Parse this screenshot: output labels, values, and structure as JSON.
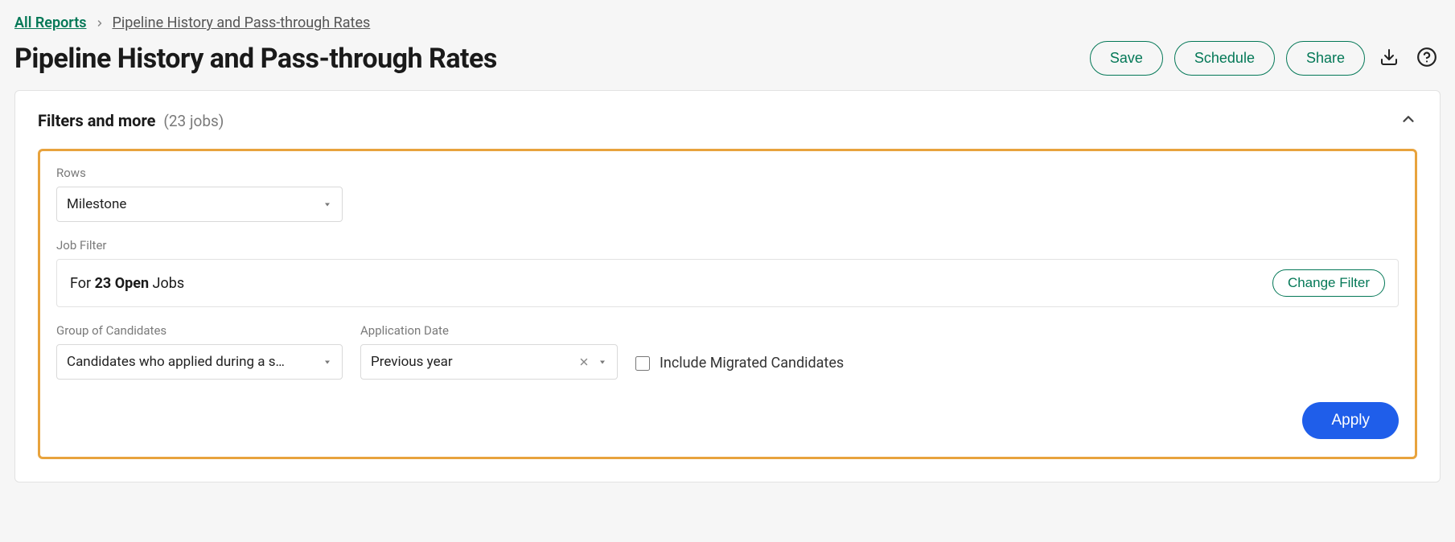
{
  "breadcrumb": {
    "root": "All Reports",
    "current": "Pipeline History and Pass-through Rates"
  },
  "page_title": "Pipeline History and Pass-through Rates",
  "actions": {
    "save": "Save",
    "schedule": "Schedule",
    "share": "Share"
  },
  "panel": {
    "title": "Filters and more",
    "subtitle": "(23 jobs)"
  },
  "filters": {
    "rows": {
      "label": "Rows",
      "value": "Milestone"
    },
    "job_filter": {
      "label": "Job Filter",
      "prefix": "For ",
      "bold": "23 Open",
      "suffix": " Jobs",
      "change_label": "Change Filter"
    },
    "group": {
      "label": "Group of Candidates",
      "value": "Candidates who applied during a s…"
    },
    "app_date": {
      "label": "Application Date",
      "value": "Previous year"
    },
    "migrated": {
      "label": "Include Migrated Candidates",
      "checked": false
    },
    "apply_label": "Apply"
  }
}
